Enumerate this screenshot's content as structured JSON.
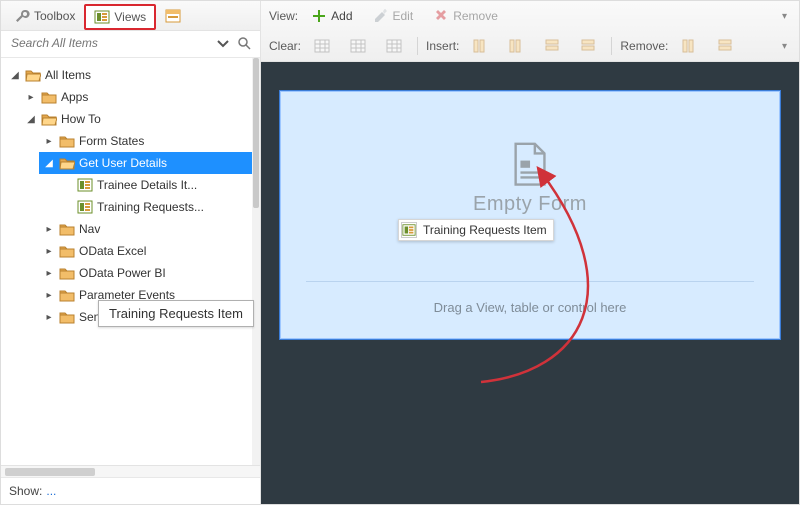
{
  "left": {
    "tabs": {
      "toolbox": "Toolbox",
      "views": "Views"
    },
    "search_placeholder": "Search All Items",
    "footer_label": "Show:",
    "footer_link": "...",
    "tree": {
      "root_label": "All Items",
      "items": [
        {
          "label": "Apps"
        },
        {
          "label": "How To",
          "children": [
            {
              "label": "Form States"
            },
            {
              "label": "Get User Details",
              "selected": true,
              "children": [
                {
                  "label": "Trainee Details It...",
                  "type": "view"
                },
                {
                  "label": "Training Requests...",
                  "type": "view"
                }
              ]
            },
            {
              "label": "Nav"
            },
            {
              "label": "OData Excel"
            },
            {
              "label": "OData Power BI"
            },
            {
              "label": "Parameter Events"
            },
            {
              "label": "SendEmailAction"
            }
          ]
        }
      ]
    },
    "tooltip": "Training Requests Item"
  },
  "toolbar": {
    "view_label": "View:",
    "add_label": "Add",
    "edit_label": "Edit",
    "remove_label": "Remove",
    "clear_label": "Clear:",
    "insert_label": "Insert:",
    "remove2_label": "Remove:"
  },
  "dropzone": {
    "empty_label": "Empty Form",
    "hint": "Drag a View, table or control here",
    "ghost_label": "Training Requests Item "
  },
  "colors": {
    "accent_green": "#4aa61b",
    "accent_red": "#d0323a",
    "select_blue": "#1e90ff",
    "folder": "#d79a3a"
  }
}
